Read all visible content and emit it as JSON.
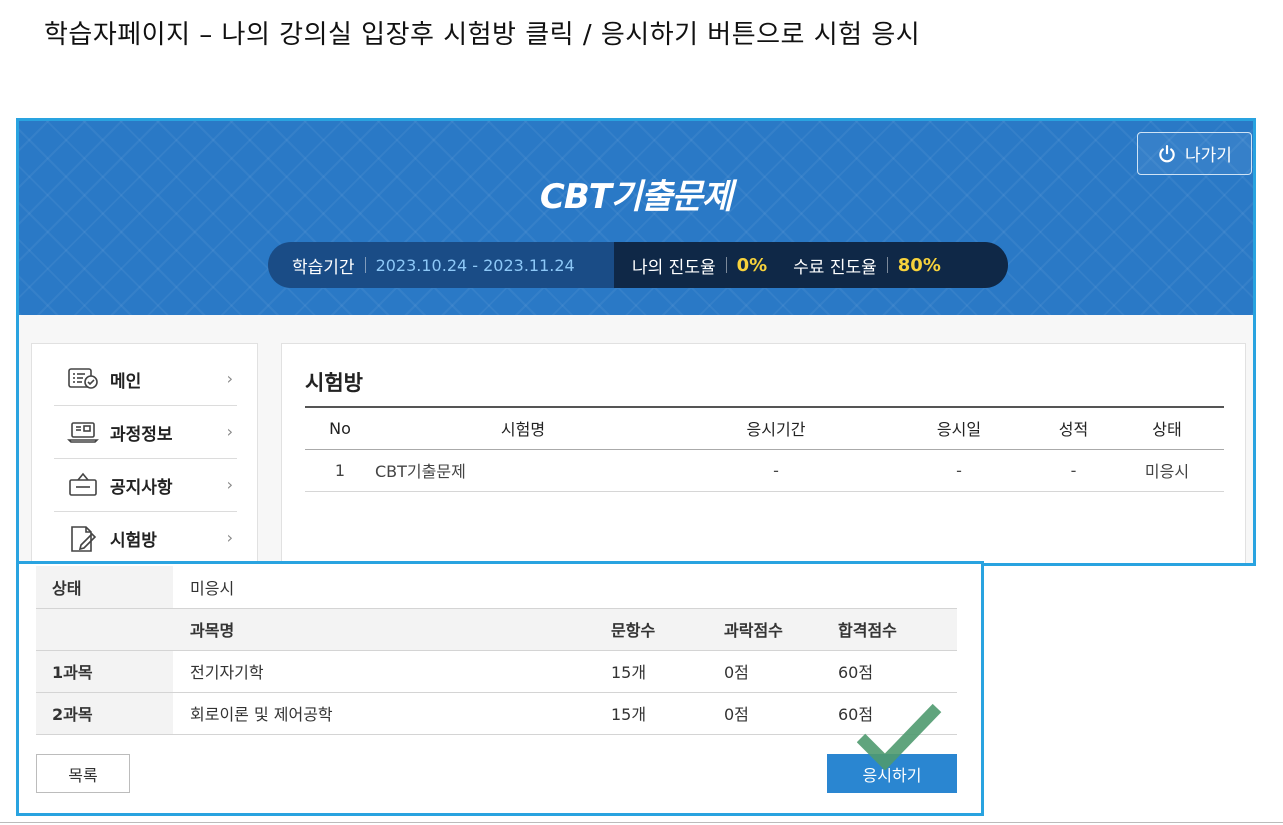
{
  "caption": "학습자페이지 – 나의 강의실 입장후 시험방 클릭 / 응시하기 버튼으로 시험 응시",
  "header": {
    "course_title": "CBT기출문제",
    "exit_label": "나가기",
    "period_label": "학습기간",
    "period_value": "2023.10.24 - 2023.11.24",
    "my_progress_label": "나의 진도율",
    "my_progress_value": "0%",
    "completion_label": "수료 진도율",
    "completion_value": "80%"
  },
  "sidebar": {
    "items": [
      {
        "label": "메인",
        "icon": "list-check-icon"
      },
      {
        "label": "과정정보",
        "icon": "laptop-icon"
      },
      {
        "label": "공지사항",
        "icon": "notice-board-icon"
      },
      {
        "label": "시험방",
        "icon": "document-edit-icon"
      }
    ],
    "chevron": "›"
  },
  "exam_room": {
    "title": "시험방",
    "columns": [
      "No",
      "시험명",
      "응시기간",
      "응시일",
      "성적",
      "상태"
    ],
    "rows": [
      {
        "no": "1",
        "name": "CBT기출문제",
        "period": "-",
        "date": "-",
        "score": "-",
        "status": "미응시"
      }
    ]
  },
  "detail": {
    "status_label": "상태",
    "status_value": "미응시",
    "columns": [
      "과목명",
      "문항수",
      "과락점수",
      "합격점수"
    ],
    "subjects": [
      {
        "label": "1과목",
        "name": "전기자기학",
        "questions": "15개",
        "fail_score": "0점",
        "pass_score": "60점"
      },
      {
        "label": "2과목",
        "name": "회로이론 및 제어공학",
        "questions": "15개",
        "fail_score": "0점",
        "pass_score": "60점"
      }
    ],
    "list_button": "목록",
    "take_button": "응시하기"
  },
  "colors": {
    "highlight_frame": "#29a3e0",
    "hero_blue": "#2a79c6",
    "accent_yellow": "#f7d23c",
    "button_blue": "#2a86d1",
    "check_green": "#4f9a6f"
  }
}
